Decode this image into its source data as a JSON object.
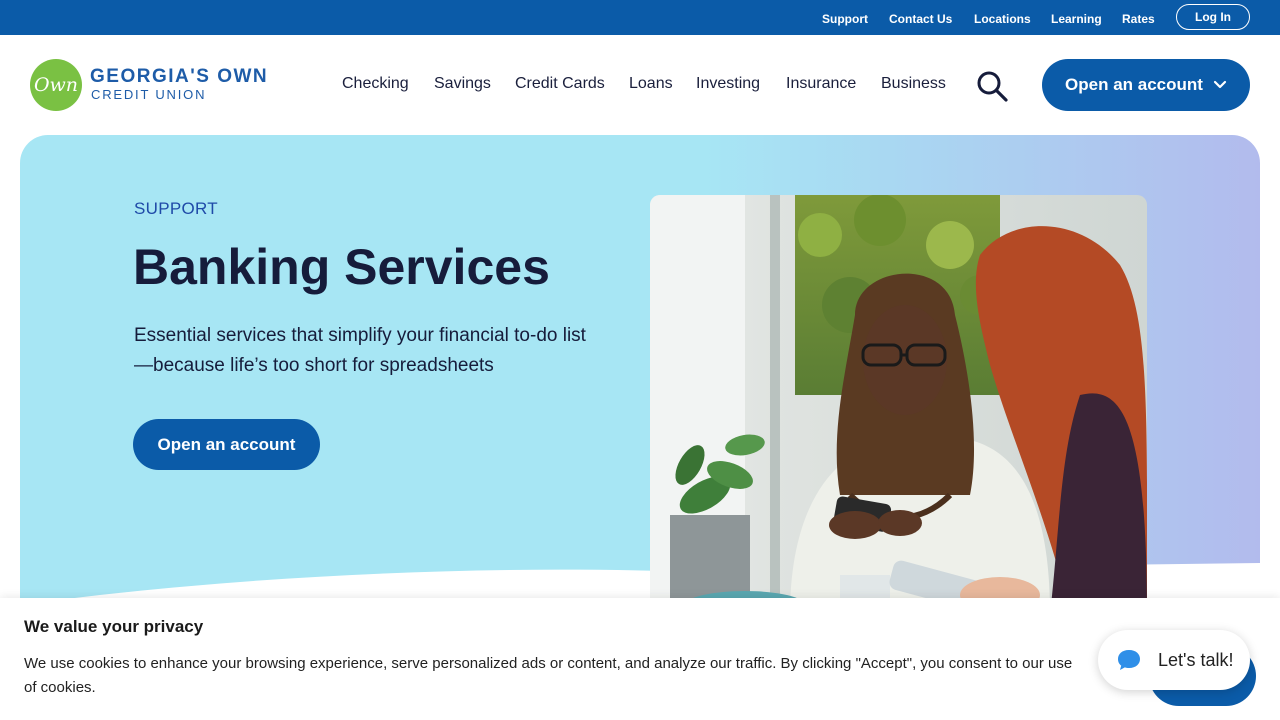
{
  "utility_nav": {
    "links": [
      "Support",
      "Contact Us",
      "Locations",
      "Learning",
      "Rates"
    ],
    "login_label": "Log In"
  },
  "brand": {
    "logo_mark": "Own",
    "name": "GEORGIA'S OWN",
    "subtitle": "CREDIT UNION",
    "logo_color": "#7ac143",
    "text_color": "#1e5ca8"
  },
  "main_nav": {
    "items": [
      "Checking",
      "Savings",
      "Credit Cards",
      "Loans",
      "Investing",
      "Insurance",
      "Business"
    ],
    "search_icon": "search-icon",
    "cta_label": "Open an account",
    "cta_icon": "chevron-down-icon"
  },
  "hero": {
    "eyebrow": "SUPPORT",
    "title": "Banking Services",
    "description": "Essential services that simplify your financial to-do list—because life’s too short for spreadsheets",
    "cta_label": "Open an account"
  },
  "cookie_banner": {
    "title": "We value your privacy",
    "text": "We use cookies to enhance your browsing experience, serve personalized ads or content, and analyze our traffic. By clicking \"Accept\", you consent to our use of cookies."
  },
  "chat": {
    "label": "Let's talk!",
    "icon": "chat-bubble-icon"
  },
  "colors": {
    "primary": "#0b5ba8",
    "hero_bg": "#a7e6f4",
    "hero_bg_end": "#b2bbed",
    "heading": "#161c3b",
    "eyebrow": "#1f4aa8"
  }
}
